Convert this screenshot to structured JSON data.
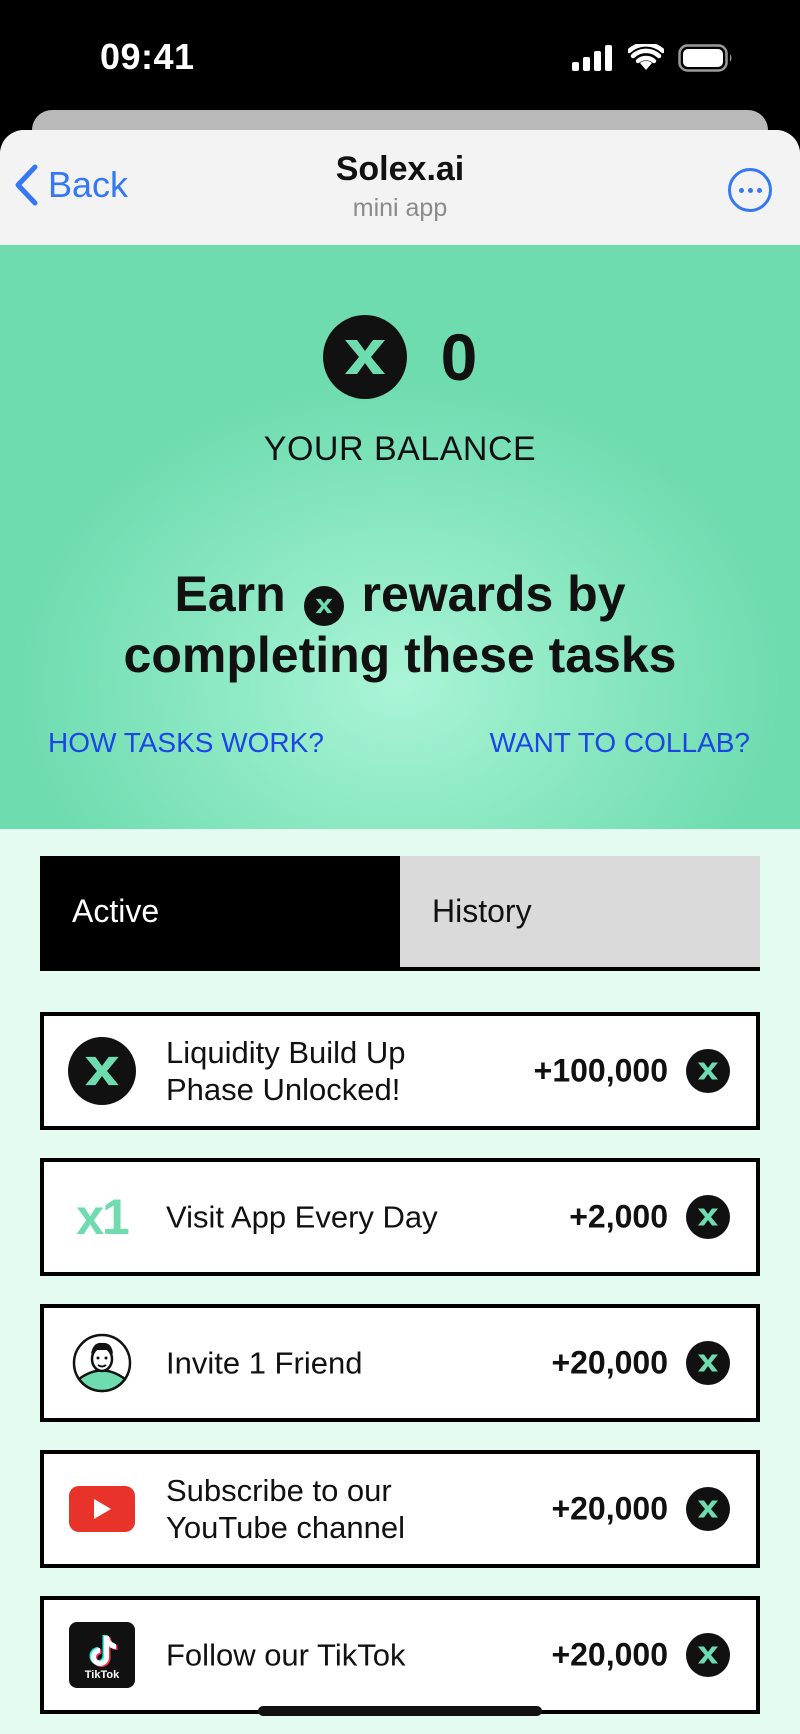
{
  "status_bar": {
    "time": "09:41"
  },
  "nav": {
    "back_label": "Back",
    "title": "Solex.ai",
    "subtitle": "mini app"
  },
  "balance": {
    "value": "0",
    "label": "YOUR BALANCE"
  },
  "hero": {
    "heading_part1": "Earn",
    "heading_part2": "rewards by",
    "heading_line2": "completing these tasks",
    "link_how": "HOW TASKS WORK?",
    "link_collab": "WANT TO COLLAB?"
  },
  "tabs": {
    "active": "Active",
    "history": "History"
  },
  "tasks": [
    {
      "icon": "solex-logo-icon",
      "title_line1": "Liquidity Build Up",
      "title_line2": "Phase Unlocked!",
      "amount": "+100,000"
    },
    {
      "icon": "x1-multiplier-icon",
      "icon_text": "x1",
      "title_line1": "Visit App Every Day",
      "title_line2": "",
      "amount": "+2,000"
    },
    {
      "icon": "friend-avatar-icon",
      "title_line1": "Invite 1 Friend",
      "title_line2": "",
      "amount": "+20,000"
    },
    {
      "icon": "youtube-icon",
      "title_line1": "Subscribe to our",
      "title_line2": "YouTube channel",
      "amount": "+20,000"
    },
    {
      "icon": "tiktok-icon",
      "icon_text": "TikTok",
      "title_line1": "Follow our TikTok",
      "title_line2": "",
      "amount": "+20,000"
    }
  ],
  "colors": {
    "accent_green": "#6fdcb0",
    "hero_glow": "#aaf5d7",
    "link_blue": "#1b45e6",
    "ios_blue": "#3478f6",
    "background": "#e4fbf1",
    "youtube_red": "#e8332a"
  }
}
